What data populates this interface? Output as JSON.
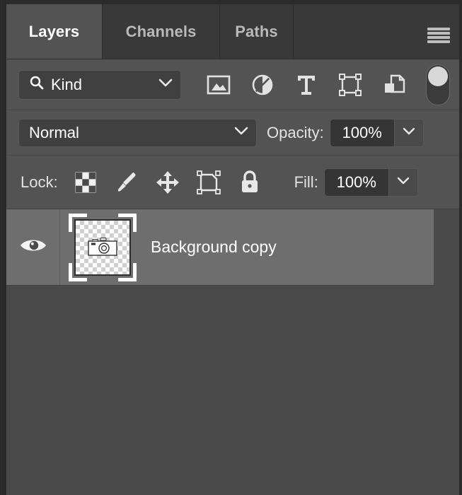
{
  "panel": {
    "title": "Layers",
    "tabs": [
      {
        "label": "Layers",
        "active": true
      },
      {
        "label": "Channels",
        "active": false
      },
      {
        "label": "Paths",
        "active": false
      }
    ],
    "menu_icon": "hamburger-menu-icon"
  },
  "filter": {
    "kind_label": "Kind",
    "search_icon": "search-icon",
    "chevron_icon": "chevron-down-icon",
    "icons": [
      {
        "name": "filter-pixel-layers-icon",
        "title": "Filter for pixel layers"
      },
      {
        "name": "filter-adjustment-layers-icon",
        "title": "Filter for adjustment layers"
      },
      {
        "name": "filter-type-layers-icon",
        "title": "Filter for type layers"
      },
      {
        "name": "filter-shape-layers-icon",
        "title": "Filter for shape layers"
      },
      {
        "name": "filter-smart-object-layers-icon",
        "title": "Filter for smart objects"
      }
    ],
    "toggle": {
      "name": "filter-enable-toggle",
      "state": "on"
    }
  },
  "blend": {
    "mode": "Normal",
    "opacity_label": "Opacity:",
    "opacity_value": "100%"
  },
  "lock": {
    "label": "Lock:",
    "icons": [
      {
        "name": "lock-transparent-pixels-icon"
      },
      {
        "name": "lock-image-pixels-icon"
      },
      {
        "name": "lock-position-icon"
      },
      {
        "name": "lock-artboard-nesting-icon"
      },
      {
        "name": "lock-all-icon"
      }
    ],
    "fill_label": "Fill:",
    "fill_value": "100%"
  },
  "layers": [
    {
      "name": "Background copy",
      "visible": true,
      "selected": true,
      "thumbnail": "transparent-camera-thumbnail"
    }
  ],
  "colors": {
    "panel_bg": "#535353",
    "list_bg": "#4a4a4a",
    "tab_inactive_bg": "#393939",
    "tab_active_bg": "#535353",
    "row_selected_bg": "#6e6e6e",
    "text_primary": "#ffffff",
    "text_secondary": "#b9b9b9"
  }
}
